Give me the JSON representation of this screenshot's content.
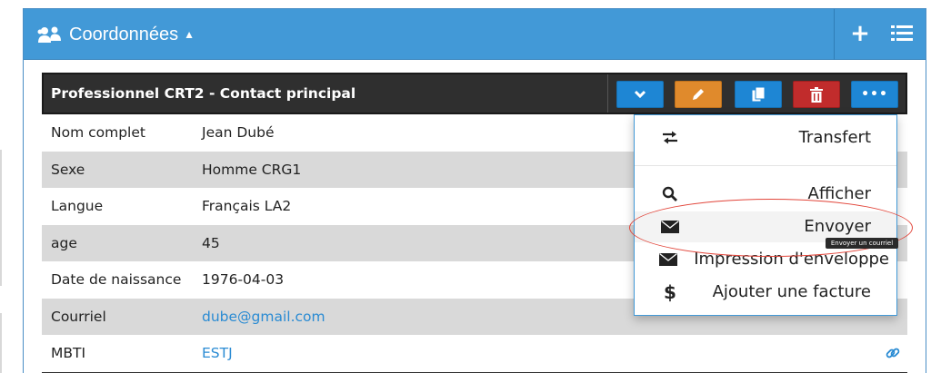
{
  "panel": {
    "title": "Coordonnées",
    "add_icon": "plus-icon",
    "list_icon": "list-icon",
    "header_color": "#4299d7"
  },
  "card": {
    "title": "Professionnel CRT2 - Contact principal",
    "buttons": [
      {
        "name": "toggle",
        "icon": "chevron-down-icon",
        "color": "#1e86d4"
      },
      {
        "name": "edit",
        "icon": "pencil-icon",
        "color": "#e08a2c"
      },
      {
        "name": "copy",
        "icon": "copy-icon",
        "color": "#1e86d4"
      },
      {
        "name": "delete",
        "icon": "trash-icon",
        "color": "#c12c2c"
      },
      {
        "name": "more",
        "icon": "more-icon",
        "label": "•••",
        "color": "#1e86d4"
      }
    ]
  },
  "fields": [
    {
      "label": "Nom complet",
      "value": "Jean Dubé"
    },
    {
      "label": "Sexe",
      "value": "Homme CRG1"
    },
    {
      "label": "Langue",
      "value": "Français LA2"
    },
    {
      "label": "age",
      "value": "45"
    },
    {
      "label": "Date de naissance",
      "value": "1976-04-03"
    },
    {
      "label": "Courriel",
      "value": "dube@gmail.com"
    },
    {
      "label": "MBTI",
      "value": "ESTJ"
    }
  ],
  "menu": {
    "items": [
      {
        "label": "Transfert",
        "icon": "exchange-icon"
      },
      {
        "label": "Afficher",
        "icon": "search-icon"
      },
      {
        "label": "Envoyer",
        "icon": "envelope-icon"
      },
      {
        "label": "Impression d'enveloppe",
        "icon": "envelope-icon"
      },
      {
        "label": "Ajouter une facture",
        "icon": "dollar-icon"
      }
    ],
    "tooltip": "Envoyer un courriel"
  }
}
